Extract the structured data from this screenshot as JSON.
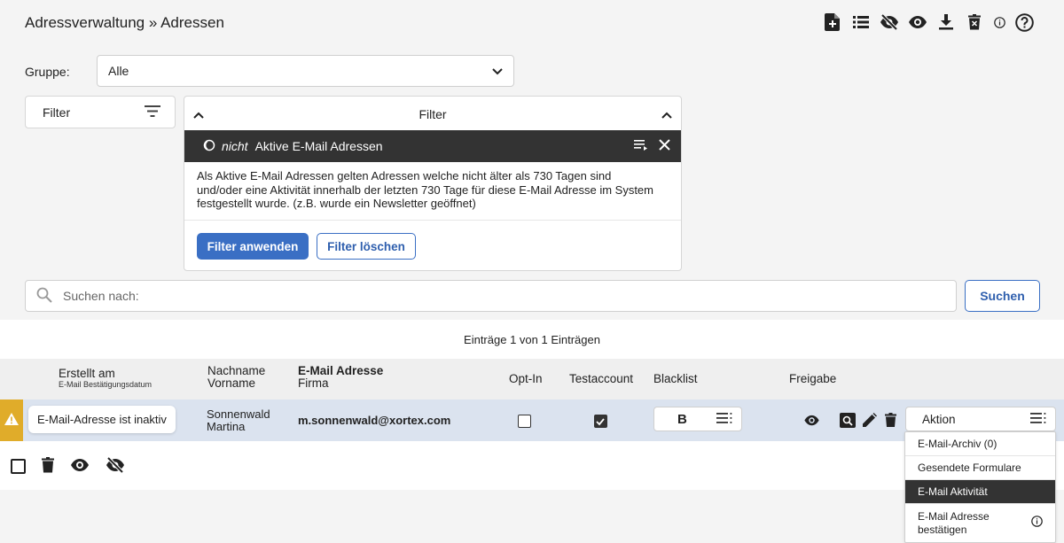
{
  "header": {
    "title": "Adressverwaltung » Adressen",
    "icons": [
      "file-add-icon",
      "list-icon",
      "eye-off-icon",
      "eye-icon",
      "download-icon",
      "trash-can-icon",
      "info-icon",
      "help-icon"
    ]
  },
  "group": {
    "label": "Gruppe:",
    "value": "Alle"
  },
  "filter": {
    "button_label": "Filter",
    "panel_title": "Filter",
    "active_filter": {
      "prefix": "nicht",
      "label": "Aktive E-Mail Adressen"
    },
    "description": "Als Aktive E-Mail Adressen gelten Adressen welche nicht älter als 730 Tagen sind und/oder eine Aktivität innerhalb der letzten 730 Tage für diese E-Mail Adresse im System festgestellt wurde. (z.B. wurde ein Newsletter geöffnet)",
    "apply_label": "Filter anwenden",
    "clear_label": "Filter löschen"
  },
  "search": {
    "placeholder": "Suchen nach:",
    "button_label": "Suchen"
  },
  "list": {
    "entries_text": "Einträge 1 von 1 Einträgen",
    "columns": {
      "created": "Erstellt am",
      "created_sub": "E-Mail Bestätigungsdatum",
      "lastname": "Nachname",
      "firstname": "Vorname",
      "email": "E-Mail Adresse",
      "company": "Firma",
      "optin": "Opt-In",
      "testaccount": "Testaccount",
      "blacklist": "Blacklist",
      "release": "Freigabe"
    },
    "rows": [
      {
        "warning_tooltip": "E-Mail-Adresse ist inaktiv",
        "lastname": "Sonnenwald",
        "firstname": "Martina",
        "email": "m.sonnenwald@xortex.com",
        "optin": false,
        "testaccount": true,
        "blacklist_label": "B",
        "action_label": "Aktion"
      }
    ]
  },
  "action_menu": {
    "items": [
      "E-Mail-Archiv (0)",
      "Gesendete Formulare",
      "E-Mail Aktivität",
      "E-Mail Adresse bestätigen"
    ],
    "active_index": 2
  },
  "colors": {
    "accent": "#3a6fc4",
    "warning": "#e0ac2a",
    "row_highlight": "#dbe3ef",
    "dark_bar": "#333333"
  }
}
